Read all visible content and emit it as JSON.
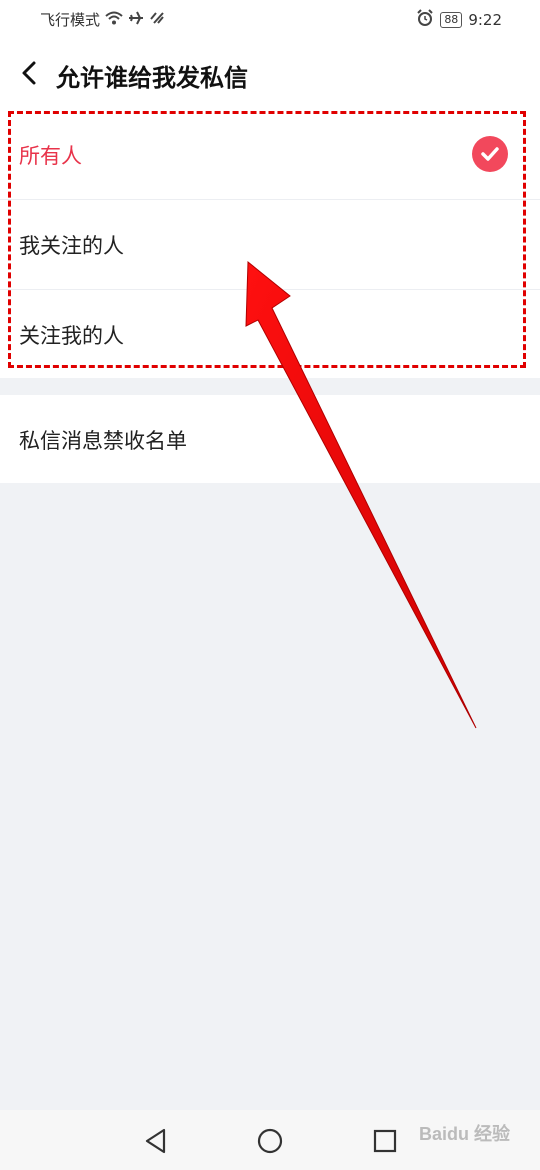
{
  "status_bar": {
    "carrier": "飞行模式",
    "battery": "88",
    "time": "9:22"
  },
  "header": {
    "title": "允许谁给我发私信"
  },
  "options": [
    {
      "label": "所有人",
      "selected": true
    },
    {
      "label": "我关注的人",
      "selected": false
    },
    {
      "label": "关注我的人",
      "selected": false
    }
  ],
  "block_list": {
    "label": "私信消息禁收名单"
  },
  "watermark": "Baidu 经验",
  "colors": {
    "accent": "#e8334a",
    "check_bg": "#f2485c",
    "annotation": "#e00000"
  }
}
